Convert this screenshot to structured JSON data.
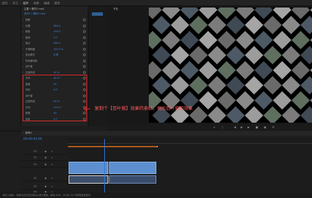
{
  "header": {
    "tabs": [
      "首页",
      "学习",
      "组件",
      "效果",
      "编辑",
      "颜色",
      "音频",
      "图形",
      "库"
    ],
    "labels": {
      "a": "源",
      "b": "效果控件",
      "c": "节目"
    }
  },
  "effect_controls": {
    "source": "主要 * 素材1.mp4",
    "seq": "序列1 * 素材1.mp4",
    "rows": [
      {
        "label": "视频",
        "value": ""
      },
      {
        "label": "位置",
        "value": "960.0"
      },
      {
        "label": "缩放",
        "value": "100.0"
      },
      {
        "label": "旋转",
        "value": "0.0"
      },
      {
        "label": "锚点",
        "value": "960.0"
      },
      {
        "label": "不透明度",
        "value": "100.0 %"
      },
      {
        "label": "混合模式",
        "value": "正常"
      },
      {
        "label": "时间重映射",
        "value": ""
      },
      {
        "label": "百叶窗",
        "value": ""
      },
      {
        "label": "过渡完成",
        "value": "50 %"
      },
      {
        "label": "方向",
        "value": "45.0 °"
      },
      {
        "label": "宽度",
        "value": "40"
      },
      {
        "label": "羽化",
        "value": "0.0"
      },
      {
        "label": "百叶窗",
        "value": ""
      },
      {
        "label": "过渡完成",
        "value": "50 %"
      },
      {
        "label": "方向",
        "value": "135.0 °"
      },
      {
        "label": "宽度",
        "value": "40"
      },
      {
        "label": "羽化",
        "value": "0.0"
      }
    ]
  },
  "annotation": "复制个【百叶窗】效果的参数，做出百叶窗的效果",
  "timeline": {
    "title": "序列1",
    "timecode": "00:00:05:00",
    "tracks": [
      "V3",
      "V2",
      "V1",
      "A1",
      "A2",
      "A3"
    ],
    "ruler": [
      "00:00",
      "00:05:00",
      "00:10:00",
      "00:15:00",
      "00:20:00"
    ]
  },
  "status": "单击以选择，或单击空白处并拖动以进行框选。使用 Shift、Alt 和 Ctrl 可获得其他选项。",
  "colors": {
    "accent": "#3d8ee6",
    "red": "#e02a2a"
  }
}
